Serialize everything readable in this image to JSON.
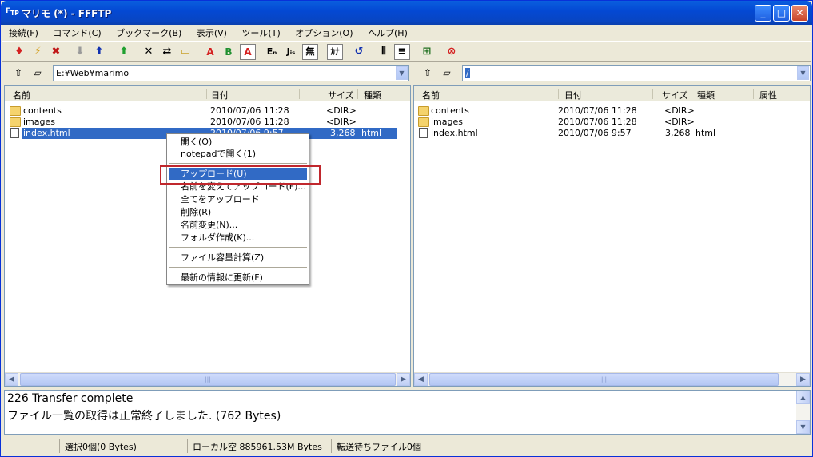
{
  "window": {
    "title": "マリモ (*) - FFFTP",
    "app_icon": "ftp-icon",
    "minimize": "_",
    "maximize": "□",
    "close": "✕"
  },
  "menu": [
    "接続(F)",
    "コマンド(C)",
    "ブックマーク(B)",
    "表示(V)",
    "ツール(T)",
    "オプション(O)",
    "ヘルプ(H)"
  ],
  "toolbar": {
    "connect": "♦",
    "quick_connect": "⚡",
    "disconnect": "✖",
    "download": "⬇",
    "upload": "⬆",
    "mirror_upload": "⬆",
    "delete": "✕",
    "rename": "⇄",
    "mkdir": "▭",
    "mode_auto": "A",
    "mode_binary": "B",
    "mode_ascii": "A",
    "kanji_euc": "Eₙ",
    "kanji_jis": "Jᵢₛ",
    "kanji_none": "無",
    "kana": "ｶﾅ",
    "refresh": "↺",
    "list_view": "⦀",
    "detail_view": "≡",
    "tree": "⊞",
    "stop": "⊗"
  },
  "local": {
    "path": "E:¥Web¥marimo",
    "columns": [
      "名前",
      "日付",
      "サイズ",
      "種類"
    ],
    "files": [
      {
        "name": "contents",
        "date": "2010/07/06 11:28",
        "size": "<DIR>",
        "type": "",
        "icon": "folder-icon"
      },
      {
        "name": "images",
        "date": "2010/07/06 11:28",
        "size": "<DIR>",
        "type": "",
        "icon": "folder-icon"
      },
      {
        "name": "index.html",
        "date": "2010/07/06  9:57",
        "size": "3,268",
        "type": "html",
        "icon": "file-icon"
      }
    ]
  },
  "remote": {
    "path": "/",
    "columns": [
      "名前",
      "日付",
      "サイズ",
      "種類",
      "属性"
    ],
    "files": [
      {
        "name": "contents",
        "date": "2010/07/06 11:28",
        "size": "<DIR>",
        "type": "",
        "icon": "folder-icon"
      },
      {
        "name": "images",
        "date": "2010/07/06 11:28",
        "size": "<DIR>",
        "type": "",
        "icon": "folder-icon"
      },
      {
        "name": "index.html",
        "date": "2010/07/06  9:57",
        "size": "3,268",
        "type": "html",
        "icon": "file-icon"
      }
    ]
  },
  "context_menu": {
    "items": [
      "開く(O)",
      "notepadで開く(1)",
      "アップロード(U)",
      "名前を変えてアップロード(F)...",
      "全てをアップロード",
      "削除(R)",
      "名前変更(N)...",
      "フォルダ作成(K)...",
      "ファイル容量計算(Z)",
      "最新の情報に更新(F)"
    ],
    "highlighted": "アップロード(U)",
    "highlight_color": "#316ac5",
    "annotation_color": "#c0272d"
  },
  "log": {
    "lines": [
      "226 Transfer complete",
      "ファイル一覧の取得は正常終了しました. (762 Bytes)"
    ]
  },
  "status": {
    "selection": "選択0個(0 Bytes)",
    "local_free": "ローカル空 885961.53M Bytes",
    "queue": "転送待ちファイル0個"
  }
}
